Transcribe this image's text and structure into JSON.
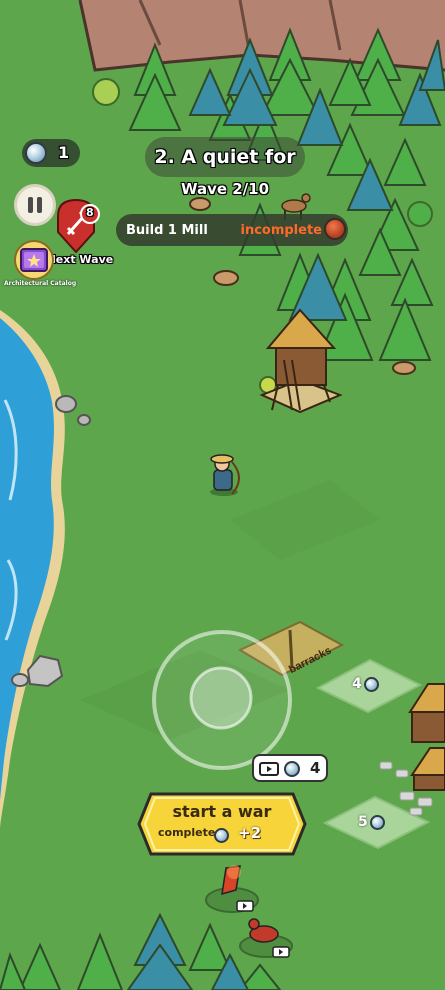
{
  "hud": {
    "gems": "1",
    "chapter_title": "2. A quiet for",
    "wave": "Wave 2/10",
    "task": {
      "label": "Build 1 Mill",
      "status": "incomplete"
    },
    "next_wave": {
      "label": "lext Wave",
      "count": "8"
    },
    "catalog_label": "Architectural Catalog"
  },
  "world": {
    "barracks_sign": "barracks",
    "build_slots": [
      {
        "cost": "4"
      },
      {
        "cost": "5"
      }
    ],
    "unlock_cost": "4"
  },
  "war_button": {
    "title": "start a war",
    "sub_label": "complete",
    "reward": "+2"
  },
  "colors": {
    "grass": "#5aa04a",
    "water": "#2f9fd8",
    "button_yellow": "#f7d43a",
    "status_orange": "#ff6a2b"
  }
}
